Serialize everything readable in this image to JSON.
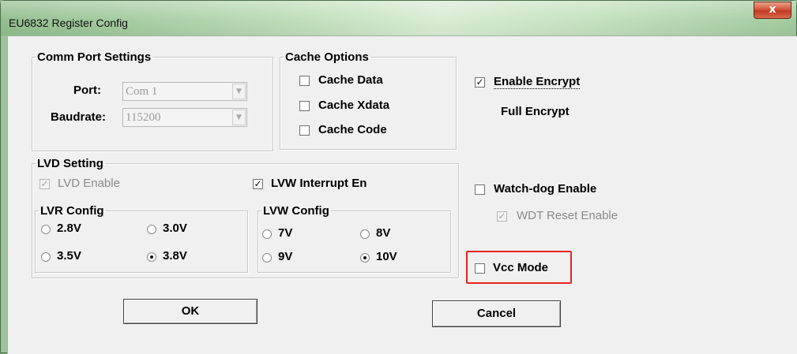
{
  "window": {
    "title": "EU6832 Register Config",
    "close_label": "x"
  },
  "comm_port": {
    "legend": "Comm Port Settings",
    "port_label": "Port:",
    "port_value": "Com 1",
    "baud_label": "Baudrate:",
    "baud_value": "115200"
  },
  "cache": {
    "legend": "Cache Options",
    "data_label": "Cache Data",
    "xdata_label": "Cache Xdata",
    "code_label": "Cache Code"
  },
  "encrypt": {
    "enable_label": "Enable Encrypt",
    "enable_checked": true,
    "mode_text": "Full Encrypt"
  },
  "lvd": {
    "legend": "LVD Setting",
    "lvd_enable_label": "LVD Enable",
    "lvw_interrupt_label": "LVW Interrupt En"
  },
  "lvr": {
    "legend": "LVR Config",
    "options": [
      "2.8V",
      "3.0V",
      "3.5V",
      "3.8V"
    ],
    "selected": "3.8V"
  },
  "lvw": {
    "legend": "LVW Config",
    "options": [
      "7V",
      "8V",
      "9V",
      "10V"
    ],
    "selected": "10V"
  },
  "watchdog": {
    "enable_label": "Watch-dog Enable",
    "wdt_reset_label": "WDT Reset Enable"
  },
  "vcc": {
    "label": "Vcc Mode",
    "highlight_color": "#e8231f"
  },
  "buttons": {
    "ok": "OK",
    "cancel": "Cancel"
  }
}
